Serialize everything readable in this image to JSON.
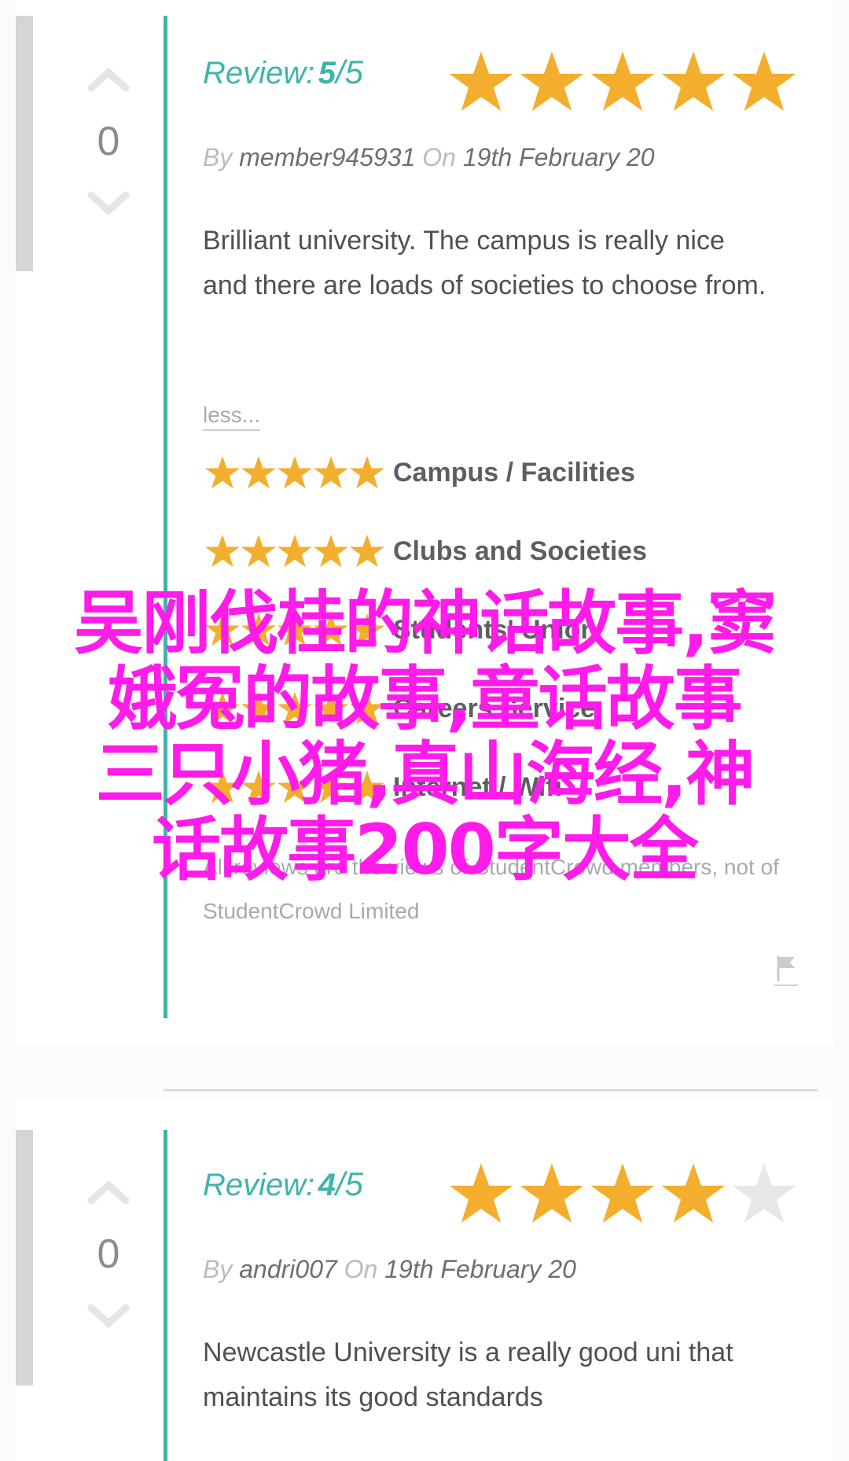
{
  "reviews": [
    {
      "votes": "0",
      "review_label": "Review:",
      "score": "5",
      "score_max": "/5",
      "stars_filled": 5,
      "by_label": "By",
      "author": "member945931",
      "on_label": "On",
      "date": "19th February 20",
      "body": "Brilliant university. The campus is really nice and there are loads of societies to choose from.",
      "less_link": "less...",
      "category_ratings": [
        {
          "label": "Campus / Facilities",
          "stars": 5
        },
        {
          "label": "Clubs and Societies",
          "stars": 5
        },
        {
          "label": "Students' Union",
          "stars": 5
        },
        {
          "label": "Careers Service",
          "stars": 5
        },
        {
          "label": "Internet / Wifi",
          "stars": 5
        }
      ],
      "disclaimer": "All reviews are the views of StudentCrowd members, not of StudentCrowd Limited"
    },
    {
      "votes": "0",
      "review_label": "Review:",
      "score": "4",
      "score_max": "/5",
      "stars_filled": 4,
      "by_label": "By",
      "author": "andri007",
      "on_label": "On",
      "date": "19th February 20",
      "body": "Newcastle University is a really good uni that maintains its good standards"
    }
  ],
  "overlay": {
    "line1": "吴刚伐桂的神话故事,窦",
    "line2": "娥冤的故事,童话故事",
    "line3": "三只小猪,真山海经,神",
    "line4": "话故事200字大全"
  },
  "colors": {
    "teal": "#3fb4aa",
    "star_gold": "#f3ae2e",
    "star_empty": "#e6e7e8",
    "overlay_magenta": "#ff1be9"
  },
  "icons": {
    "upvote": "chevron-up-icon",
    "downvote": "chevron-down-icon",
    "star": "star-icon",
    "flag": "flag-icon"
  }
}
